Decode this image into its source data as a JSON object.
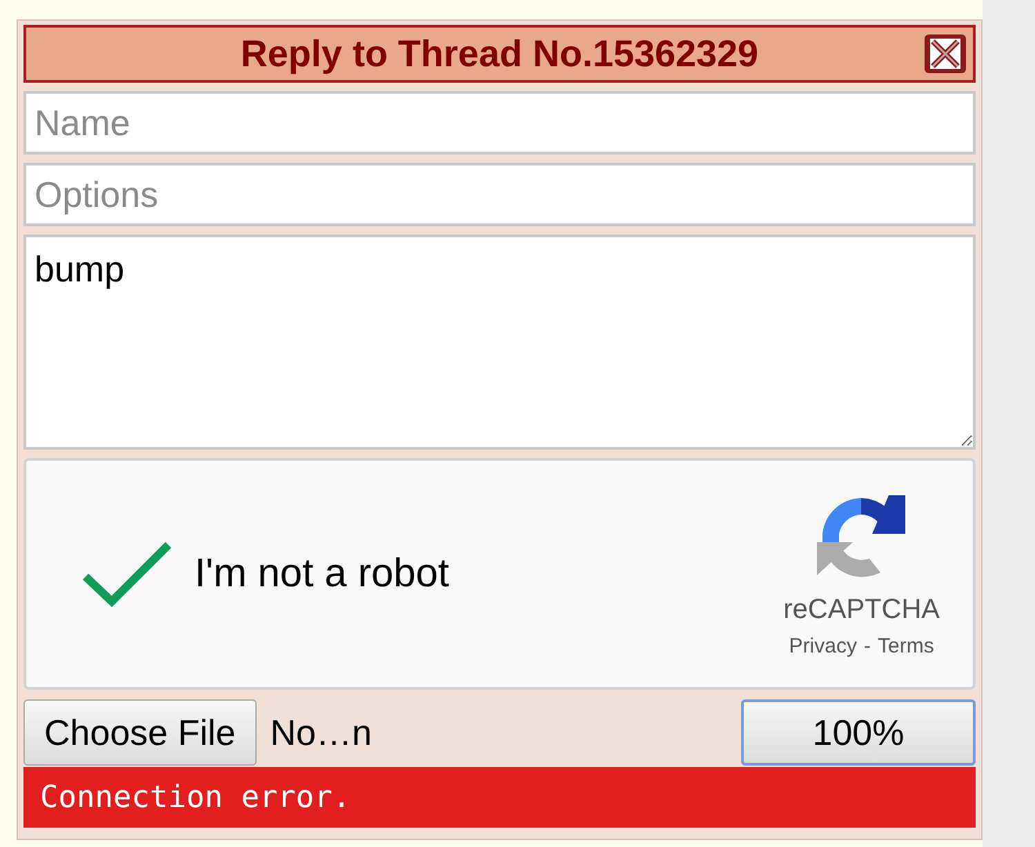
{
  "window": {
    "title": "Reply to Thread No.15362329"
  },
  "fields": [
    {
      "kind": "input",
      "placeholder": "Name"
    },
    {
      "kind": "input",
      "placeholder": "Options"
    },
    {
      "kind": "textarea",
      "value": "bump"
    }
  ],
  "captcha": {
    "label": "I'm not a robot",
    "checked": true,
    "brand": "reCAPTCHA",
    "privacy": "Privacy",
    "separator": "-",
    "terms": "Terms"
  },
  "file": {
    "button": "Choose File",
    "filename": "No…n"
  },
  "submit": {
    "label": "100%"
  },
  "status": {
    "message": "Connection error."
  }
}
